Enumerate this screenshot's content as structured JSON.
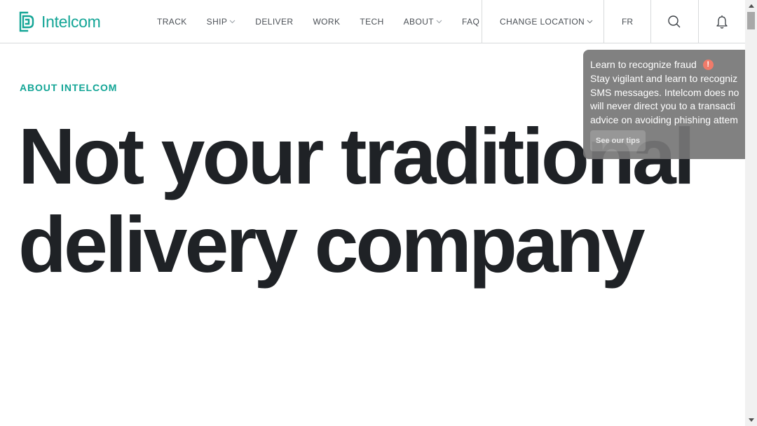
{
  "brand": {
    "name": "Intelcom",
    "accent": "#13a596"
  },
  "nav": {
    "items": [
      {
        "label": "TRACK",
        "has_dropdown": false
      },
      {
        "label": "SHIP",
        "has_dropdown": true
      },
      {
        "label": "DELIVER",
        "has_dropdown": false
      },
      {
        "label": "WORK",
        "has_dropdown": false
      },
      {
        "label": "TECH",
        "has_dropdown": false
      },
      {
        "label": "ABOUT",
        "has_dropdown": true
      },
      {
        "label": "FAQ",
        "has_dropdown": false
      }
    ],
    "change_location": "CHANGE LOCATION",
    "language": "FR",
    "icons": [
      "search-icon",
      "bell-icon"
    ]
  },
  "hero": {
    "eyebrow": "ABOUT INTELCOM",
    "line1": "Not your traditional",
    "line2": "delivery company"
  },
  "toast": {
    "title": "Learn to recognize fraud",
    "alert_icon": "!",
    "lines": [
      "Stay vigilant and learn to recogniz",
      "SMS messages. Intelcom does no",
      "will never direct you to a transacti",
      "advice on avoiding phishing attem"
    ],
    "button": "See our tips"
  }
}
